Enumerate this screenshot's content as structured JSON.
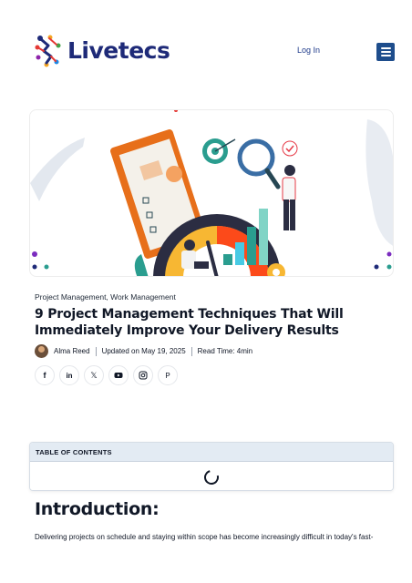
{
  "header": {
    "brand": "Livetecs",
    "login_label": "Log In",
    "menu_icon": "hamburger-icon",
    "brand_color": "#1e2a78",
    "menu_color": "#1e4d8c"
  },
  "hero": {
    "illustration": "project-management-illustration"
  },
  "article": {
    "categories": "Project Management, Work Management",
    "title": "9 Project Management Techniques That Will Immediately Improve Your Delivery Results",
    "author": "Alma Reed",
    "updated": "Updated on May 19, 2025",
    "read_time": "Read Time: 4min"
  },
  "share": [
    {
      "icon": "facebook-icon",
      "glyph": "f"
    },
    {
      "icon": "linkedin-icon",
      "glyph": "in"
    },
    {
      "icon": "x-icon",
      "glyph": "𝕏"
    },
    {
      "icon": "youtube-icon",
      "glyph": ""
    },
    {
      "icon": "instagram-icon",
      "glyph": ""
    },
    {
      "icon": "pinterest-icon",
      "glyph": "P"
    }
  ],
  "toc": {
    "heading": "TABLE OF CONTENTS"
  },
  "intro": {
    "heading": "Introduction:",
    "text": "Delivering projects on schedule and staying within scope has become increasingly difficult in today's fast-"
  }
}
